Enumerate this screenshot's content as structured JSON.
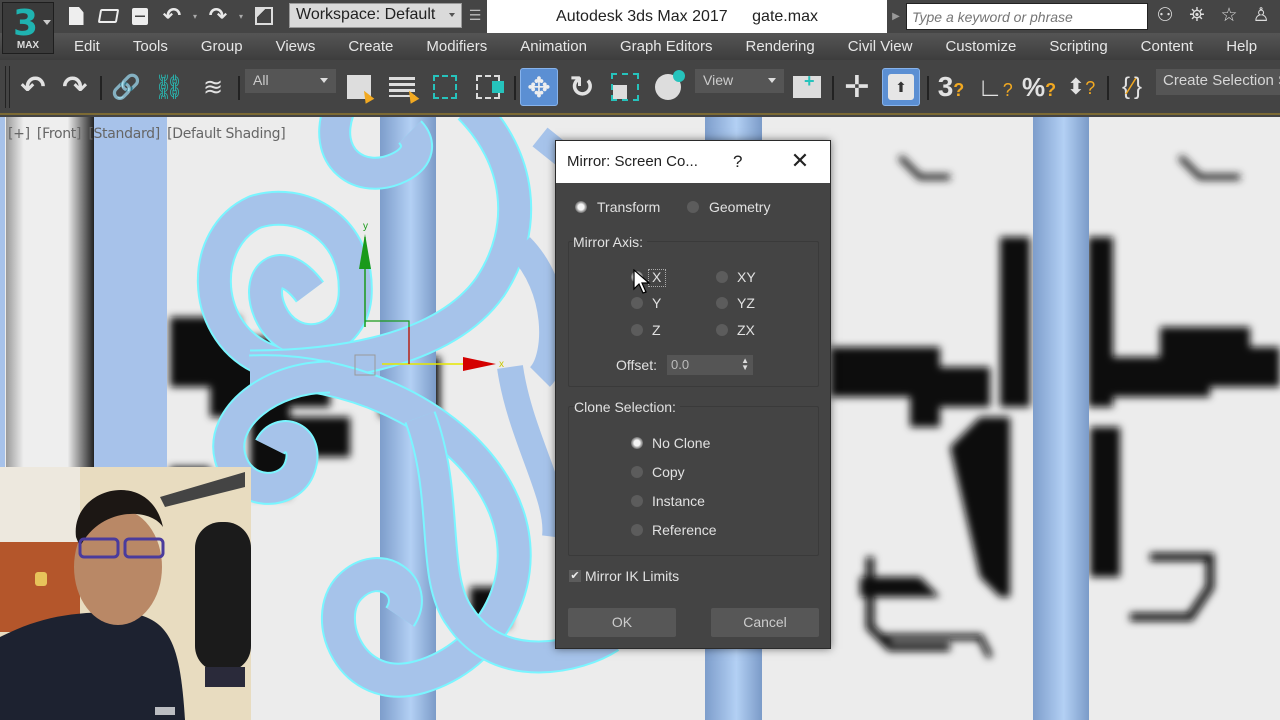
{
  "app": {
    "logo_main": "3",
    "logo_sub": "MAX",
    "title": "Autodesk 3ds Max 2017",
    "file": "gate.max",
    "workspace": "Workspace: Default",
    "search_placeholder": "Type a keyword or phrase"
  },
  "quick_access": [
    {
      "icon": "new-file-icon",
      "glyph": "🗋"
    },
    {
      "icon": "open-folder-icon",
      "glyph": "📂"
    },
    {
      "icon": "save-icon",
      "glyph": "💾"
    },
    {
      "icon": "undo-icon",
      "glyph": "↶"
    },
    {
      "icon": "redo-icon",
      "glyph": "↷"
    },
    {
      "icon": "project-folder-icon",
      "glyph": "🗂"
    }
  ],
  "title_icons": [
    {
      "icon": "binoculars-icon",
      "glyph": "⌕"
    },
    {
      "icon": "satellite-icon",
      "glyph": "📡"
    },
    {
      "icon": "star-icon",
      "glyph": "☆"
    },
    {
      "icon": "user-icon",
      "glyph": "👤"
    }
  ],
  "menu": [
    "Edit",
    "Tools",
    "Group",
    "Views",
    "Create",
    "Modifiers",
    "Animation",
    "Graph Editors",
    "Rendering",
    "Civil View",
    "Customize",
    "Scripting",
    "Content",
    "Help"
  ],
  "toolbar": {
    "undo": "↶",
    "redo": "↷",
    "selection_filter": "All",
    "reference_coord": "View",
    "named_selection": "Create Selection S",
    "snap_3d": "3",
    "percent": "%"
  },
  "viewport": {
    "labels": [
      "[+]",
      "[Front]",
      "[Standard]",
      "[Default Shading]"
    ],
    "gizmo_x": "x",
    "gizmo_y": "y"
  },
  "dialog": {
    "title": "Mirror: Screen Co...",
    "help": "?",
    "close": "✕",
    "mode_options": [
      {
        "label": "Transform",
        "selected": true
      },
      {
        "label": "Geometry",
        "selected": false
      }
    ],
    "mirror_axis_title": "Mirror Axis:",
    "axes": [
      {
        "label": "X",
        "selected": true
      },
      {
        "label": "Y",
        "selected": false
      },
      {
        "label": "Z",
        "selected": false
      },
      {
        "label": "XY",
        "selected": false
      },
      {
        "label": "YZ",
        "selected": false
      },
      {
        "label": "ZX",
        "selected": false
      }
    ],
    "offset_label": "Offset:",
    "offset_value": "0.0",
    "clone_title": "Clone Selection:",
    "clone_options": [
      {
        "label": "No Clone",
        "selected": true
      },
      {
        "label": "Copy",
        "selected": false
      },
      {
        "label": "Instance",
        "selected": false
      },
      {
        "label": "Reference",
        "selected": false
      }
    ],
    "mirror_ik_label": "Mirror IK Limits",
    "mirror_ik_checked": true,
    "ok": "OK",
    "cancel": "Cancel"
  },
  "colors": {
    "accent_blue": "#5b8fd3",
    "teal": "#26c3bc",
    "selection_cyan": "#7af5ff",
    "object_blue": "#a6c3ea",
    "gizmo_x": "#d40000",
    "gizmo_y": "#1a9a1a"
  }
}
